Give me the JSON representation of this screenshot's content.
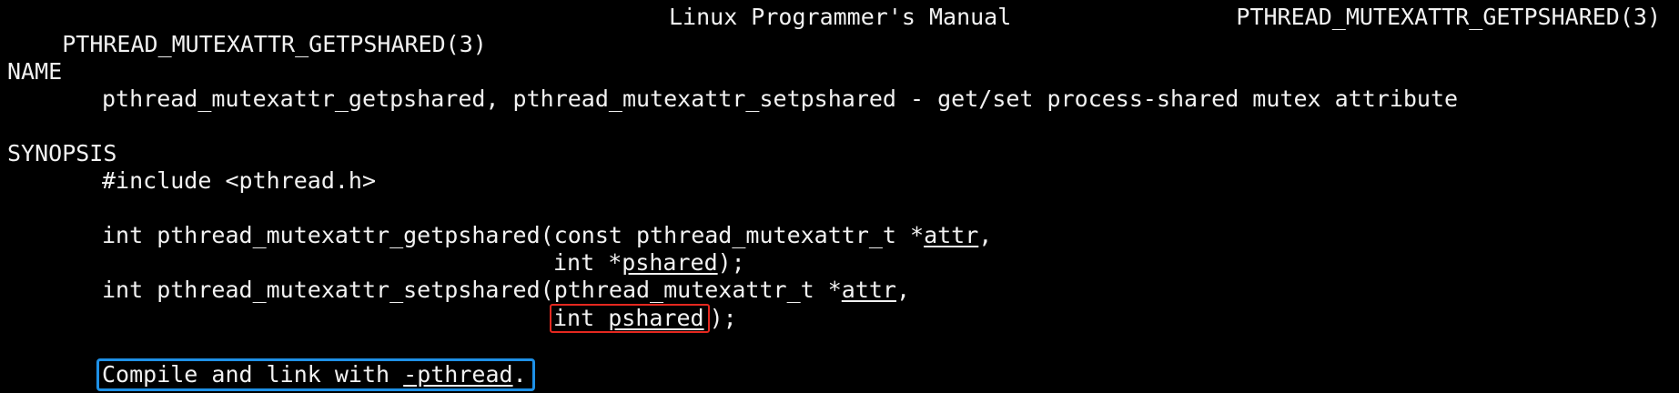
{
  "header": {
    "left": "PTHREAD_MUTEXATTR_GETPSHARED(3)",
    "center": "Linux Programmer's Manual",
    "right": "PTHREAD_MUTEXATTR_GETPSHARED(3)"
  },
  "name_section": {
    "heading": "NAME",
    "description": "pthread_mutexattr_getpshared, pthread_mutexattr_setpshared - get/set process-shared mutex attribute"
  },
  "synopsis": {
    "heading": "SYNOPSIS",
    "include": "#include <pthread.h>",
    "get_proto_1": "int pthread_mutexattr_getpshared(const pthread_mutexattr_t *",
    "get_arg1": "attr",
    "get_proto_1_end": ",",
    "get_proto_2": "int *",
    "get_arg2": "pshared",
    "get_proto_2_end": ");",
    "set_proto_1": "int pthread_mutexattr_setpshared(pthread_mutexattr_t *",
    "set_arg1": "attr",
    "set_proto_1_end": ",",
    "set_proto_2": "int ",
    "set_arg2": "pshared",
    "set_proto_2_end": ");",
    "link_text": "Compile and link with ",
    "link_flag": "-pthread",
    "link_end": "."
  },
  "colors": {
    "background": "#000000",
    "text": "#f2f2f2",
    "highlight_red": "#e5281f",
    "highlight_blue": "#1e90e6"
  }
}
